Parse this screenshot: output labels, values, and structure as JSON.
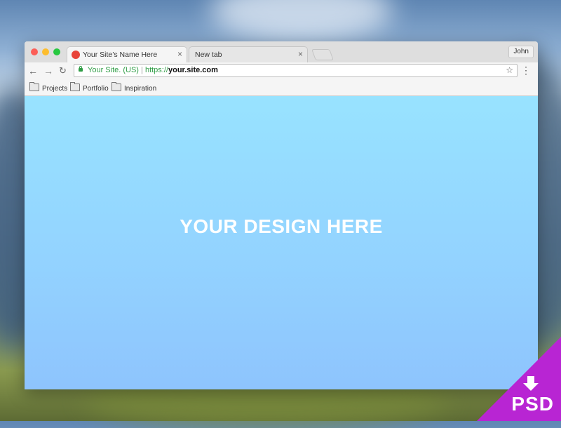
{
  "window": {
    "tabs": [
      {
        "label": "Your Site’s Name Here",
        "active": true,
        "favicon_color": "#e8443a"
      },
      {
        "label": "New tab",
        "active": false
      }
    ],
    "profile": "John"
  },
  "address_bar": {
    "org": "Your Site. (US)",
    "separator": "|",
    "scheme": "https://",
    "host": "your.site.com",
    "secure_color": "#2f9d45"
  },
  "bookmarks": [
    {
      "label": "Projects"
    },
    {
      "label": "Portfolio"
    },
    {
      "label": "Inspiration"
    }
  ],
  "viewport": {
    "headline": "YOUR DESIGN HERE"
  },
  "badge": {
    "label": "PSD",
    "color": "#b825d3"
  },
  "icons": {
    "back": "arrow-left-icon",
    "forward": "arrow-right-icon",
    "reload": "reload-icon",
    "bookmark": "star-icon",
    "menu": "kebab-menu-icon",
    "folder": "folder-icon",
    "download": "download-arrow-icon"
  }
}
